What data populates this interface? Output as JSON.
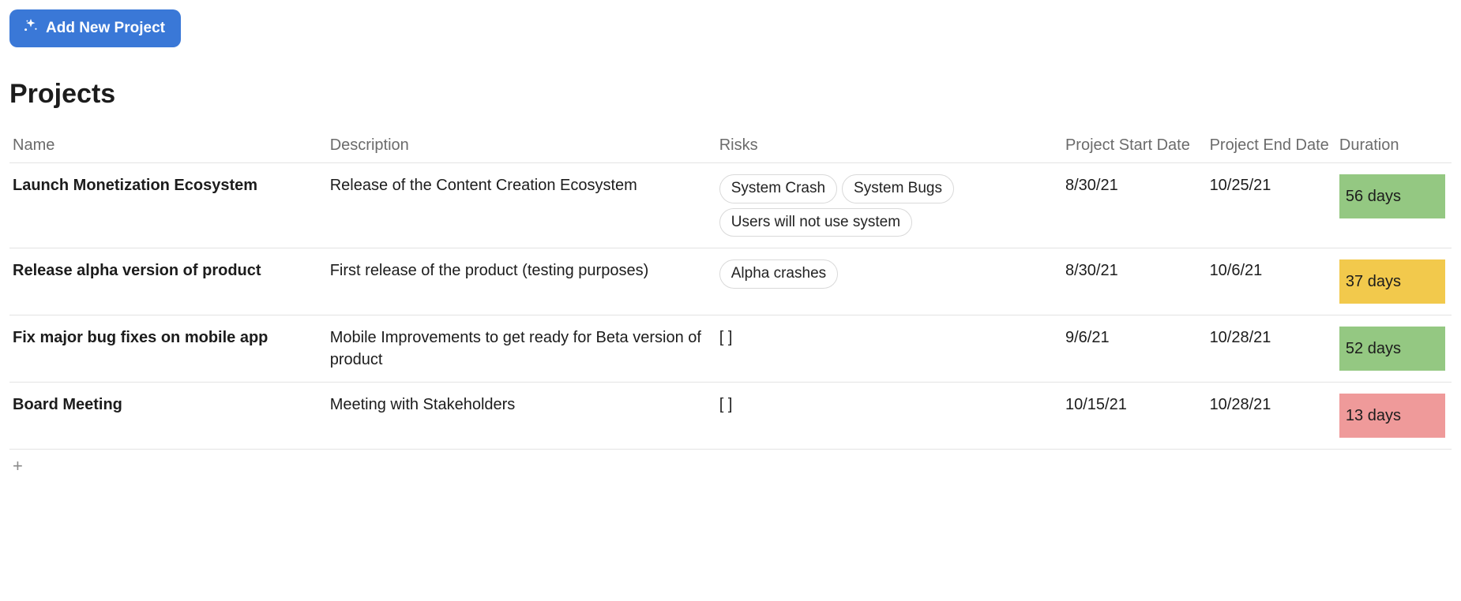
{
  "toolbar": {
    "add_button_label": "Add New Project"
  },
  "page": {
    "title": "Projects"
  },
  "table": {
    "columns": {
      "name": "Name",
      "description": "Description",
      "risks": "Risks",
      "start": "Project Start Date",
      "end": "Project End Date",
      "duration": "Duration"
    },
    "rows": [
      {
        "name": "Launch Monetization Ecosystem",
        "description": "Release of the Content Creation Ecosystem",
        "risks": [
          "System Crash",
          "System Bugs",
          "Users will not use system"
        ],
        "start": "8/30/21",
        "end": "10/25/21",
        "duration": "56 days",
        "duration_color": "green"
      },
      {
        "name": "Release alpha version of product",
        "description": "First release of the product (testing purposes)",
        "risks": [
          "Alpha crashes"
        ],
        "start": "8/30/21",
        "end": "10/6/21",
        "duration": "37 days",
        "duration_color": "yellow"
      },
      {
        "name": "Fix major bug fixes on mobile app",
        "description": "Mobile Improvements to get ready for Beta version of product",
        "risks": [],
        "start": "9/6/21",
        "end": "10/28/21",
        "duration": "52 days",
        "duration_color": "green"
      },
      {
        "name": "Board Meeting",
        "description": "Meeting with Stakeholders",
        "risks": [],
        "start": "10/15/21",
        "end": "10/28/21",
        "duration": "13 days",
        "duration_color": "red"
      }
    ],
    "add_row_label": "+",
    "empty_risks_display": "[ ]"
  }
}
